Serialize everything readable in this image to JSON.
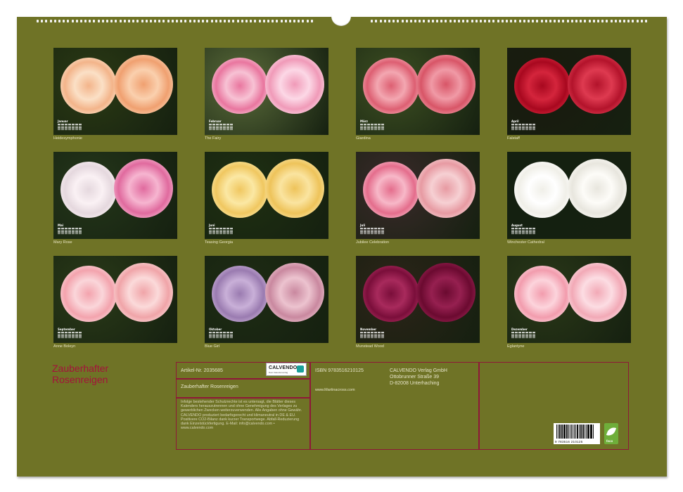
{
  "thumbnails": [
    {
      "caption": "Heidesymphonie",
      "month": "Januar",
      "bg": "#2b3a14",
      "roses": [
        [
          "#f3b48a",
          "#fbe0c6"
        ],
        [
          "#f0a070",
          "#fad0ae"
        ]
      ]
    },
    {
      "caption": "The Fairy",
      "month": "Februar",
      "bg": "#5a6b3a",
      "roses": [
        [
          "#e9769f",
          "#f7c2d4"
        ],
        [
          "#f09ab8",
          "#fcd8e6"
        ]
      ]
    },
    {
      "caption": "Giardina",
      "month": "März",
      "bg": "#3d4f22",
      "roses": [
        [
          "#dd5f72",
          "#f3a7b1"
        ],
        [
          "#d85567",
          "#f09aa6"
        ]
      ]
    },
    {
      "caption": "Falstaff",
      "month": "April",
      "bg": "#1a1a0e",
      "roses": [
        [
          "#a8081f",
          "#d4253c"
        ],
        [
          "#b3132b",
          "#de3a50"
        ]
      ]
    },
    {
      "caption": "Mary Rose",
      "month": "Mai",
      "bg": "#24361a",
      "roses": [
        [
          "#e5d8de",
          "#faf1f4"
        ],
        [
          "#e06a9e",
          "#f6b5d0"
        ]
      ]
    },
    {
      "caption": "Teasing Georgia",
      "month": "Juni",
      "bg": "#1f3012",
      "roses": [
        [
          "#f0c760",
          "#fbe8a4"
        ],
        [
          "#eec35a",
          "#fae4a0"
        ]
      ]
    },
    {
      "caption": "Jubilee Celebration",
      "month": "Juli",
      "bg": "#3a2a2a",
      "roses": [
        [
          "#e46d8c",
          "#f7b8c8"
        ],
        [
          "#e79aa2",
          "#f6d0d3"
        ]
      ]
    },
    {
      "caption": "Winchester Cathedral",
      "month": "August",
      "bg": "#142010",
      "roses": [
        [
          "#f0efe8",
          "#ffffff"
        ],
        [
          "#e8e6de",
          "#fdfcf8"
        ]
      ]
    },
    {
      "caption": "Anne Boleyn",
      "month": "September",
      "bg": "#2a3a18",
      "roses": [
        [
          "#f3a3ad",
          "#fad6da"
        ],
        [
          "#f0a4a8",
          "#fbdada"
        ]
      ]
    },
    {
      "caption": "Blue Girl",
      "month": "Oktober",
      "bg": "#1e2c14",
      "roses": [
        [
          "#9a7bb0",
          "#c9b0d8"
        ],
        [
          "#c9889f",
          "#ecc3cf"
        ]
      ]
    },
    {
      "caption": "Munstead Wood",
      "month": "November",
      "bg": "#2c2418",
      "roses": [
        [
          "#7a0e3a",
          "#a82a5c"
        ],
        [
          "#6b0a30",
          "#962050"
        ]
      ]
    },
    {
      "caption": "Eglantyne",
      "month": "Dezember",
      "bg": "#2a3818",
      "roses": [
        [
          "#f29cad",
          "#fcd4dc"
        ],
        [
          "#f2a9b6",
          "#fcdde3"
        ]
      ]
    }
  ],
  "title_line1": "Zauberhafter",
  "title_line2": "Rosenreigen",
  "info": {
    "article": "Artikel-Nr. 2035685",
    "isbn": "ISBN 9783516210125",
    "publisher_name": "CALVENDO Verlag GmbH",
    "publisher_street": "Ottobrunner Straße 39",
    "publisher_city": "D-82008 Unterhaching",
    "subtitle": "Zauberhafter Rosenreigen",
    "website": "www.Martinacross.com",
    "legal": "Infolge bestehender Schutzrechte ist es untersagt, die Blätter dieses Kalenders herauszutrennen und ohne Genehmigung des Verlages zu gewerblichen Zwecken weiterzuverwenden. Alle Angaben ohne Gewähr. CALVENDO produziert bedarfsgerecht und klimaneutral in DE & EU. Positivere CO2-Bilanz dank kurzer Transportwege. Abfall-Reduzierung dank Einzelstückfertigung. E-Mail: info@calvendo.com • www.calvendo.com",
    "logo_name": "CALVENDO",
    "logo_sub": "Dein Kalenderverlag",
    "barcode_number": "9 783516 210125",
    "eco_label": "feco"
  },
  "colors": {
    "page_background": "#6f7326",
    "accent": "#a4123b",
    "frame": "#8e1838"
  }
}
